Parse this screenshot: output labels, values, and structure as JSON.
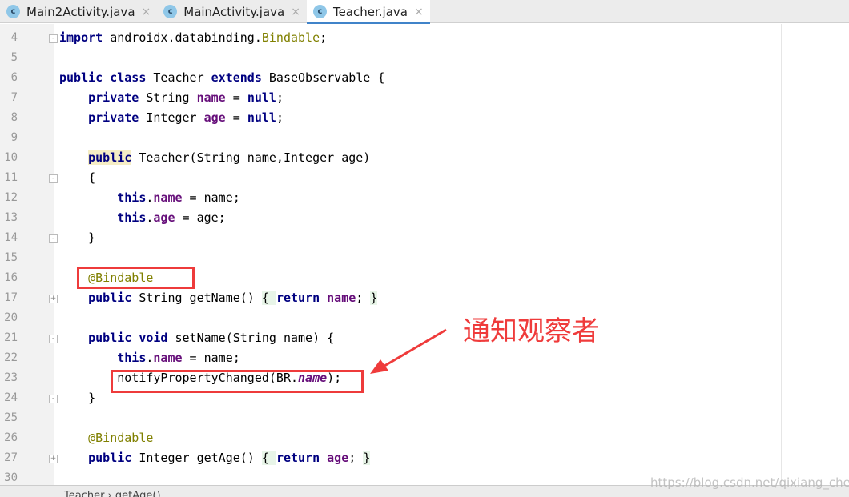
{
  "tabs": [
    {
      "label": "Main2Activity.java",
      "icon": "class-icon",
      "active": false
    },
    {
      "label": "MainActivity.java",
      "icon": "class-icon",
      "active": false
    },
    {
      "label": "Teacher.java",
      "icon": "class-icon",
      "active": true
    }
  ],
  "class_icon_letter": "c",
  "close_glyph": "×",
  "lines": [
    {
      "n": "4",
      "fold": "-",
      "t": [
        [
          "import",
          "kw"
        ],
        [
          " androidx.databinding.",
          ""
        ],
        [
          "Bindable",
          "an"
        ],
        [
          ";",
          ""
        ]
      ]
    },
    {
      "n": "5",
      "t": []
    },
    {
      "n": "6",
      "t": [
        [
          "public",
          "kw"
        ],
        [
          " ",
          ""
        ],
        [
          "class",
          "kw"
        ],
        [
          " Teacher ",
          ""
        ],
        [
          "extends",
          "kw"
        ],
        [
          " BaseObservable {",
          ""
        ]
      ]
    },
    {
      "n": "7",
      "t": [
        [
          "    ",
          ""
        ],
        [
          "private",
          "kw"
        ],
        [
          " String ",
          ""
        ],
        [
          "name",
          "fd"
        ],
        [
          " = ",
          ""
        ],
        [
          "null",
          "kw"
        ],
        [
          ";",
          ""
        ]
      ]
    },
    {
      "n": "8",
      "t": [
        [
          "    ",
          ""
        ],
        [
          "private",
          "kw"
        ],
        [
          " Integer ",
          ""
        ],
        [
          "age",
          "fd"
        ],
        [
          " = ",
          ""
        ],
        [
          "null",
          "kw"
        ],
        [
          ";",
          ""
        ]
      ]
    },
    {
      "n": "9",
      "t": []
    },
    {
      "n": "10",
      "t": [
        [
          "    ",
          ""
        ],
        [
          "public",
          "kwh"
        ],
        [
          " Teacher(String name,Integer age)",
          ""
        ]
      ]
    },
    {
      "n": "11",
      "fold": "-",
      "t": [
        [
          "    {",
          ""
        ]
      ]
    },
    {
      "n": "12",
      "t": [
        [
          "        ",
          ""
        ],
        [
          "this",
          "kw"
        ],
        [
          ".",
          ""
        ],
        [
          "name",
          "fd"
        ],
        [
          " = name;",
          ""
        ]
      ]
    },
    {
      "n": "13",
      "t": [
        [
          "        ",
          ""
        ],
        [
          "this",
          "kw"
        ],
        [
          ".",
          ""
        ],
        [
          "age",
          "fd"
        ],
        [
          " = age;",
          ""
        ]
      ]
    },
    {
      "n": "14",
      "fold": "-",
      "t": [
        [
          "    }",
          ""
        ]
      ]
    },
    {
      "n": "15",
      "t": []
    },
    {
      "n": "16",
      "t": [
        [
          "    ",
          ""
        ],
        [
          "@Bindable",
          "an"
        ]
      ]
    },
    {
      "n": "17",
      "fold": "+",
      "t": [
        [
          "    ",
          ""
        ],
        [
          "public",
          "kw"
        ],
        [
          " String getName() ",
          ""
        ],
        [
          "{ ",
          "fb"
        ],
        [
          "return",
          "kw"
        ],
        [
          " ",
          ""
        ],
        [
          "name",
          "fd"
        ],
        [
          "; ",
          ""
        ],
        [
          "}",
          "fb"
        ]
      ]
    },
    {
      "n": "20",
      "t": []
    },
    {
      "n": "21",
      "fold": "-",
      "t": [
        [
          "    ",
          ""
        ],
        [
          "public",
          "kw"
        ],
        [
          " ",
          ""
        ],
        [
          "void",
          "kw"
        ],
        [
          " setName(String name) {",
          ""
        ]
      ]
    },
    {
      "n": "22",
      "t": [
        [
          "        ",
          ""
        ],
        [
          "this",
          "kw"
        ],
        [
          ".",
          ""
        ],
        [
          "name",
          "fd"
        ],
        [
          " = name;",
          ""
        ]
      ]
    },
    {
      "n": "23",
      "t": [
        [
          "        notifyPropertyChanged(BR.",
          ""
        ],
        [
          "name",
          "fdi"
        ],
        [
          ");",
          ""
        ]
      ]
    },
    {
      "n": "24",
      "fold": "-",
      "t": [
        [
          "    }",
          ""
        ]
      ]
    },
    {
      "n": "25",
      "t": []
    },
    {
      "n": "26",
      "t": [
        [
          "    ",
          ""
        ],
        [
          "@Bindable",
          "an"
        ]
      ]
    },
    {
      "n": "27",
      "fold": "+",
      "t": [
        [
          "    ",
          ""
        ],
        [
          "public",
          "kw"
        ],
        [
          " Integer getAge() ",
          ""
        ],
        [
          "{ ",
          "fb"
        ],
        [
          "return",
          "kw"
        ],
        [
          " ",
          ""
        ],
        [
          "age",
          "fd"
        ],
        [
          "; ",
          ""
        ],
        [
          "}",
          "fb"
        ]
      ]
    },
    {
      "n": "30",
      "t": []
    }
  ],
  "breadcrumb": "Teacher  ›  getAge()",
  "annotation": {
    "text": "通知观察者",
    "color": "#ef3b3b"
  },
  "watermark": "https://blog.csdn.net/qixiang_chen"
}
